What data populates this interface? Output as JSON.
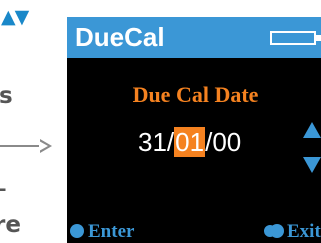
{
  "doc_fragment": {
    "nav_arrows": "▲▼",
    "text_s": "s",
    "text_dash": "-",
    "text_re": "re"
  },
  "device": {
    "app_title": "DueCal",
    "screen_heading": "Due Cal Date",
    "date": {
      "day": "31",
      "separator": "/",
      "month": "01",
      "year": "00"
    },
    "softkeys": {
      "left_label": "Enter",
      "right_label": "Exit"
    },
    "icons": {
      "battery": "battery-icon",
      "up": "up-arrow-icon",
      "down": "down-arrow-icon",
      "enter_key": "single-dot-icon",
      "exit_key": "double-dot-icon"
    },
    "colors": {
      "title_bar": "#3b97d6",
      "screen_bg": "#000000",
      "heading": "#f58220",
      "selection": "#f58220",
      "softkey": "#3b97d6"
    }
  }
}
